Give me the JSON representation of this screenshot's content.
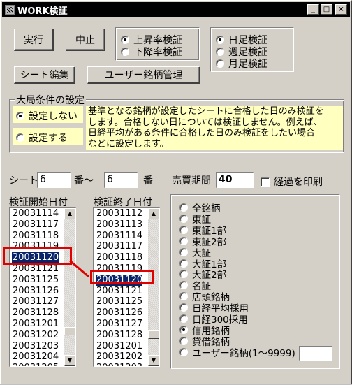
{
  "window": {
    "title": "WORK検証"
  },
  "title_buttons": {
    "minimize": "_",
    "maximize": "□",
    "close": "×"
  },
  "toolbar": {
    "run_label": "実行",
    "stop_label": "中止",
    "sheet_edit_label": "シート編集",
    "user_symbol_label": "ユーザー銘柄管理"
  },
  "mode": {
    "rise_label": "上昇率検証",
    "fall_label": "下降率検証"
  },
  "period": {
    "daily_label": "日足検証",
    "weekly_label": "週足検証",
    "monthly_label": "月足検証"
  },
  "overall": {
    "group_title": "大局条件の設定",
    "off_label": "設定しない",
    "on_label": "設定する",
    "note_lines": [
      "基準となる銘柄が設定したシートに合格した日のみ検証を",
      "します。合格しない日については検証しません。例えば、",
      "日経平均がある条件に合格した日のみ検証をしたい場合",
      "などに設定します。"
    ]
  },
  "sheet_range": {
    "label": "シート",
    "from_value": "6",
    "mid_label": "番～",
    "to_value": "6",
    "end_label": "番"
  },
  "trade_period": {
    "label": "売買期間",
    "value": "40",
    "print_label": "経過を印刷"
  },
  "start_list": {
    "header": "検証開始日付",
    "items": [
      "20031114",
      "20031117",
      "20031118",
      "20031119",
      "20031120",
      "20031121",
      "20031125",
      "20031126",
      "20031127",
      "20031128",
      "20031201",
      "20031202",
      "20031203",
      "20031204",
      "20031205"
    ],
    "selected": "20031120"
  },
  "end_list": {
    "header": "検証終了日付",
    "items": [
      "20031112",
      "20031113",
      "20031114",
      "20031117",
      "20031118",
      "20031119",
      "20031120",
      "20031121",
      "20031125",
      "20031126",
      "20031127",
      "20031128",
      "20031201",
      "20031202",
      "20031203"
    ],
    "selected": "20031120"
  },
  "market_options": {
    "items": [
      "全銘柄",
      "東証",
      "東証1部",
      "東証2部",
      "大証",
      "大証1部",
      "大証2部",
      "名証",
      "店頭銘柄",
      "日経平均採用",
      "日経300採用",
      "信用銘柄",
      "貸借銘柄",
      "ユーザー銘柄(1～9999)"
    ],
    "selected": "信用銘柄"
  },
  "colors": {
    "highlight": "#e00000",
    "note_bg": "#ffffc0",
    "selection": "#0a246a"
  }
}
